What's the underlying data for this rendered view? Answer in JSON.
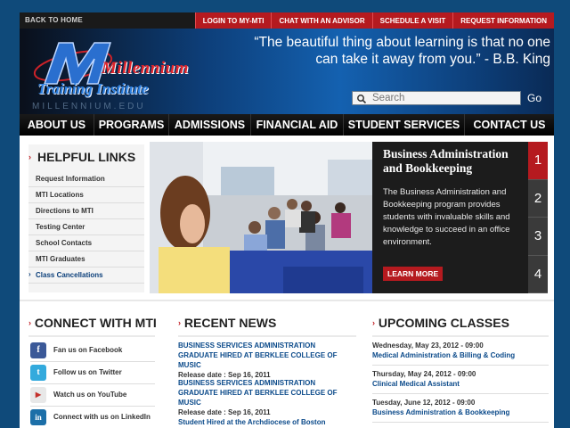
{
  "topbar": {
    "back_home": "BACK TO HOME",
    "links": [
      "LOGIN TO MY-MTI",
      "CHAT WITH AN ADVISOR",
      "SCHEDULE A VISIT",
      "REQUEST INFORMATION"
    ]
  },
  "header": {
    "logo_line1": "Millennium",
    "logo_line2": "Training Institute",
    "logo_domain": "MILLENNIUM.EDU",
    "quote": "“The beautiful thing about learning is that no one can take it away from you.” - B.B. King",
    "search_placeholder": "Search",
    "go_label": "Go"
  },
  "nav": [
    "ABOUT US",
    "PROGRAMS",
    "ADMISSIONS",
    "FINANCIAL AID",
    "STUDENT SERVICES",
    "CONTACT US"
  ],
  "helpful_links": {
    "title": "HELPFUL LINKS",
    "items": [
      "Request Information",
      "MTI Locations",
      "Directions to MTI",
      "Testing Center",
      "School Contacts",
      "MTI Graduates",
      "Class Cancellations"
    ]
  },
  "slider": {
    "title": "Business Administration and Bookkeeping",
    "description": "The Business Administration and Bookkeeping program provides students with invaluable skills and knowledge to succeed in an office environment.",
    "button": "LEARN MORE",
    "numbers": [
      "1",
      "2",
      "3",
      "4"
    ],
    "active": "1"
  },
  "connect": {
    "title": "CONNECT WITH MTI",
    "items": [
      {
        "label": "Fan us on Facebook",
        "icon": "facebook-icon",
        "glyph": "f",
        "color": "#3b5998"
      },
      {
        "label": "Follow us on Twitter",
        "icon": "twitter-icon",
        "glyph": "t",
        "color": "#33aadd"
      },
      {
        "label": "Watch us on YouTube",
        "icon": "youtube-icon",
        "glyph": "▶",
        "color": "#e8e8e8"
      },
      {
        "label": "Connect with us on LinkedIn",
        "icon": "linkedin-icon",
        "glyph": "in",
        "color": "#1c6fa8"
      }
    ]
  },
  "news": {
    "title": "RECENT NEWS",
    "items": [
      {
        "title": "BUSINESS SERVICES ADMINISTRATION GRADUATE HIRED AT BERKLEE COLLEGE OF MUSIC",
        "date": "Release date : Sep 16, 2011"
      },
      {
        "title": "BUSINESS SERVICES ADMINISTRATION GRADUATE HIRED AT BERKLEE COLLEGE OF MUSIC",
        "date": "Release date : Sep 16, 2011"
      },
      {
        "title": "Student Hired at the Archdiocese of Boston",
        "date": ""
      }
    ]
  },
  "classes": {
    "title": "UPCOMING CLASSES",
    "items": [
      {
        "date": "Wednesday, May 23, 2012 - 09:00",
        "name": "Medical Administration & Billing & Coding"
      },
      {
        "date": "Thursday, May 24, 2012 - 09:00",
        "name": "Clinical Medical Assistant"
      },
      {
        "date": "Tuesday, June 12, 2012 - 09:00",
        "name": "Business Administration & Bookkeeping"
      }
    ]
  },
  "colors": {
    "accent_red": "#b51a1f",
    "link_blue": "#0b4a8a",
    "background": "#0f4a7a"
  }
}
